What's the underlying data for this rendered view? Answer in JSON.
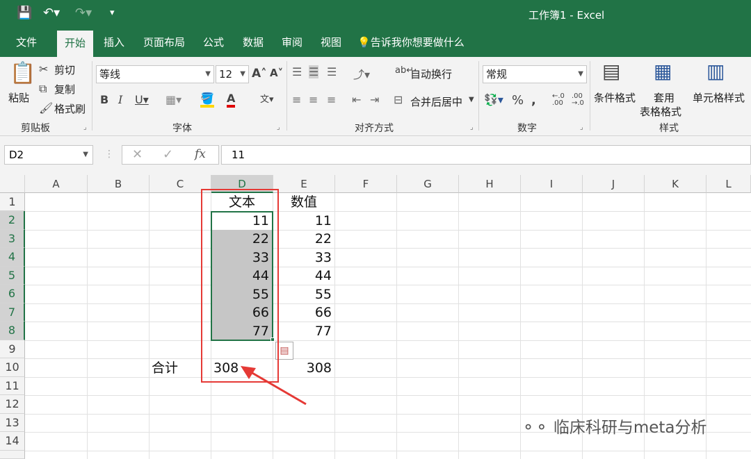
{
  "title_bar": {
    "title": "工作簿1  -  Excel"
  },
  "tabs": [
    {
      "label": "文件"
    },
    {
      "label": "开始"
    },
    {
      "label": "插入"
    },
    {
      "label": "页面布局"
    },
    {
      "label": "公式"
    },
    {
      "label": "数据"
    },
    {
      "label": "审阅"
    },
    {
      "label": "视图"
    }
  ],
  "tell_me": "告诉我你想要做什么",
  "ribbon": {
    "clipboard": {
      "label": "剪贴板",
      "paste": "粘贴",
      "cut": "剪切",
      "copy": "复制",
      "format_painter": "格式刷"
    },
    "font": {
      "label": "字体",
      "font_name": "等线",
      "font_size": "12"
    },
    "alignment": {
      "label": "对齐方式",
      "wrap_text": "自动换行",
      "merge_center": "合并后居中"
    },
    "number": {
      "label": "数字",
      "format": "常规"
    },
    "styles": {
      "label": "样式",
      "conditional": "条件格式",
      "table_format_1": "套用",
      "table_format_2": "表格格式",
      "cell_styles": "单元格样式"
    }
  },
  "formula_bar": {
    "name_box": "D2",
    "formula": "11"
  },
  "sheet": {
    "columns": [
      "A",
      "B",
      "C",
      "D",
      "E",
      "F",
      "G",
      "H",
      "I",
      "J",
      "K",
      "L"
    ],
    "rows": [
      "1",
      "2",
      "3",
      "4",
      "5",
      "6",
      "7",
      "8",
      "9",
      "10",
      "11",
      "12",
      "13",
      "14"
    ],
    "header_d": "文本",
    "header_e": "数值",
    "col_d": [
      "11",
      "22",
      "33",
      "44",
      "55",
      "66",
      "77"
    ],
    "col_e": [
      "11",
      "22",
      "33",
      "44",
      "55",
      "66",
      "77"
    ],
    "total_label": "合计",
    "total_d": "308",
    "total_e": "308"
  },
  "colors": {
    "brand": "#217346",
    "annotation": "#e53935"
  },
  "watermark": "临床科研与meta分析"
}
